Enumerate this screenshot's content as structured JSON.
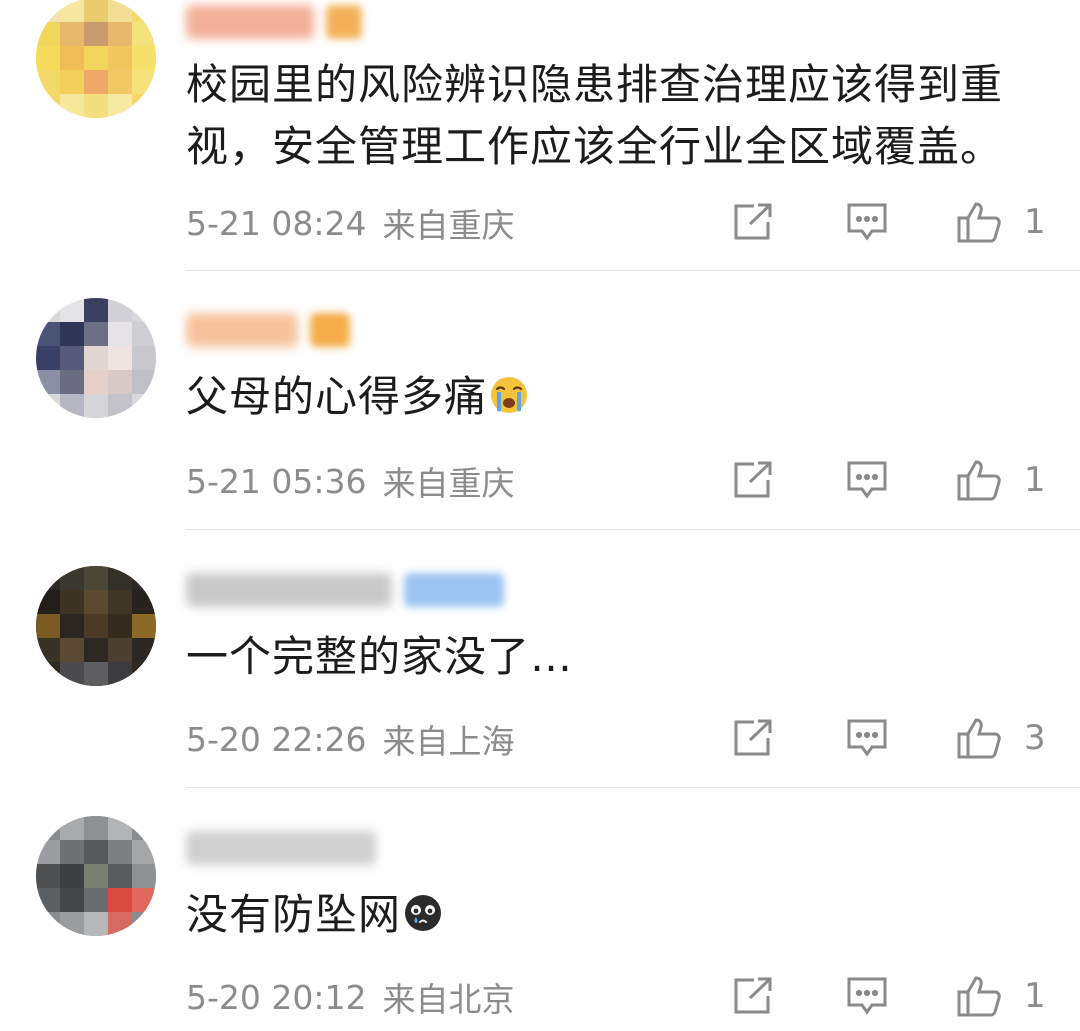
{
  "comments": [
    {
      "text": "校园里的风险辨识隐患排查治理应该得到重视，安全管理工作应该全行业全区域覆盖。",
      "time": "5-21 08:24",
      "location": "来自重庆",
      "likes": "1",
      "emoji": ""
    },
    {
      "text": "父母的心得多痛",
      "time": "5-21 05:36",
      "location": "来自重庆",
      "likes": "1",
      "emoji": "crying-face-emoji"
    },
    {
      "text": "一个完整的家没了…",
      "time": "5-20 22:26",
      "location": "来自上海",
      "likes": "3",
      "emoji": ""
    },
    {
      "text": "没有防坠网",
      "time": "5-20 20:12",
      "location": "来自北京",
      "likes": "1",
      "emoji": "tearful-black-face-emoji"
    }
  ],
  "icons": {
    "repost": "repost-icon",
    "comment": "comment-icon",
    "like": "thumbs-up-icon"
  },
  "colors": {
    "meta_text": "#8c8c8c",
    "divider": "#e6e6e6",
    "body_text": "#1c1c1c"
  }
}
